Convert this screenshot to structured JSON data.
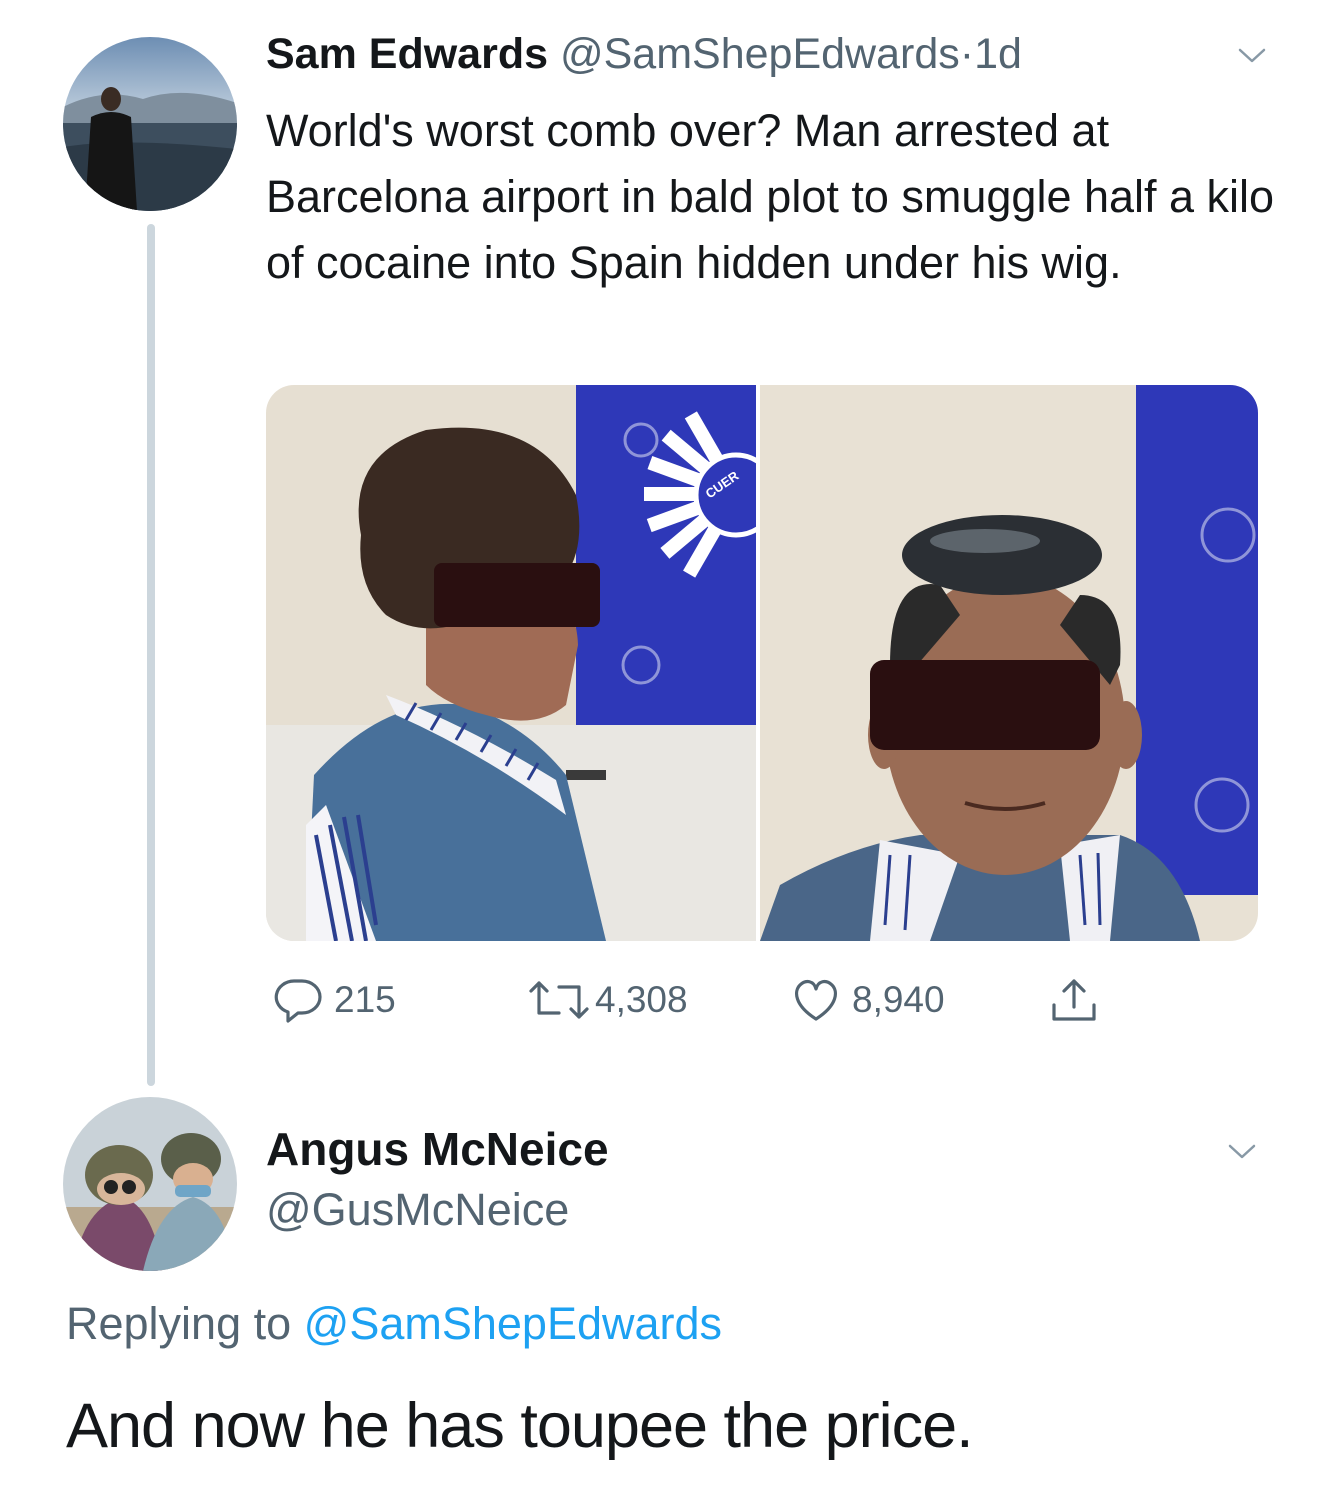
{
  "tweet": {
    "author_name": "Sam Edwards",
    "author_handle": "@SamShepEdwards",
    "separator": "·",
    "time": "1d",
    "text": "World's worst comb over? Man arrested at Barcelona airport in bald plot to smuggle half a kilo of cocaine into Spain hidden under his wig.",
    "media_seal_text": "CUER",
    "stats": {
      "replies": "215",
      "retweets": "4,308",
      "likes": "8,940"
    }
  },
  "reply": {
    "author_name": "Angus McNeice",
    "author_handle": "@GusMcNeice",
    "replying_prefix": "Replying to",
    "replying_to": "@SamShepEdwards",
    "text": "And now he has toupee the price."
  },
  "colors": {
    "text_primary": "#14171a",
    "text_secondary": "#536471",
    "mention_blue": "#1da1f2",
    "thread_line": "#ccd6dd",
    "police_blue": "#2e38b8"
  },
  "icons": [
    "reply-icon",
    "retweet-icon",
    "like-icon",
    "share-icon",
    "chevron-down-icon"
  ]
}
